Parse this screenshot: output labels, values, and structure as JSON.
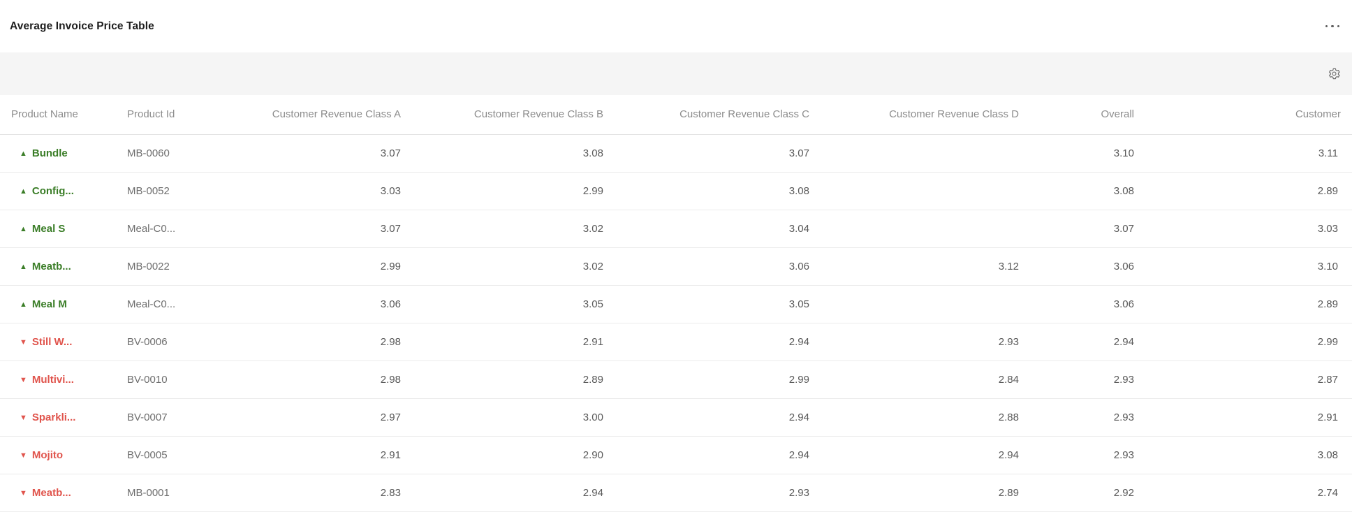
{
  "widget": {
    "title": "Average Invoice Price Table",
    "icons": {
      "more_options": "ellipsis-menu",
      "settings": "gear"
    }
  },
  "table": {
    "columns": [
      "Product Name",
      "Product Id",
      "Customer Revenue Class A",
      "Customer Revenue Class B",
      "Customer Revenue Class C",
      "Customer Revenue Class D",
      "Overall",
      "Customer"
    ],
    "rows": [
      {
        "trend": "up",
        "trend_icon": "▲",
        "name": "Bundle",
        "product_id": "MB-0060",
        "class_a": "3.07",
        "class_b": "3.08",
        "class_c": "3.07",
        "class_d": "",
        "overall": "3.10",
        "customer": "3.11"
      },
      {
        "trend": "up",
        "trend_icon": "▲",
        "name": "Config...",
        "product_id": "MB-0052",
        "class_a": "3.03",
        "class_b": "2.99",
        "class_c": "3.08",
        "class_d": "",
        "overall": "3.08",
        "customer": "2.89"
      },
      {
        "trend": "up",
        "trend_icon": "▲",
        "name": "Meal S",
        "product_id": "Meal-C0...",
        "class_a": "3.07",
        "class_b": "3.02",
        "class_c": "3.04",
        "class_d": "",
        "overall": "3.07",
        "customer": "3.03"
      },
      {
        "trend": "up",
        "trend_icon": "▲",
        "name": "Meatb...",
        "product_id": "MB-0022",
        "class_a": "2.99",
        "class_b": "3.02",
        "class_c": "3.06",
        "class_d": "3.12",
        "overall": "3.06",
        "customer": "3.10"
      },
      {
        "trend": "up",
        "trend_icon": "▲",
        "name": "Meal M",
        "product_id": "Meal-C0...",
        "class_a": "3.06",
        "class_b": "3.05",
        "class_c": "3.05",
        "class_d": "",
        "overall": "3.06",
        "customer": "2.89"
      },
      {
        "trend": "down",
        "trend_icon": "▼",
        "name": "Still W...",
        "product_id": "BV-0006",
        "class_a": "2.98",
        "class_b": "2.91",
        "class_c": "2.94",
        "class_d": "2.93",
        "overall": "2.94",
        "customer": "2.99"
      },
      {
        "trend": "down",
        "trend_icon": "▼",
        "name": "Multivi...",
        "product_id": "BV-0010",
        "class_a": "2.98",
        "class_b": "2.89",
        "class_c": "2.99",
        "class_d": "2.84",
        "overall": "2.93",
        "customer": "2.87"
      },
      {
        "trend": "down",
        "trend_icon": "▼",
        "name": "Sparkli...",
        "product_id": "BV-0007",
        "class_a": "2.97",
        "class_b": "3.00",
        "class_c": "2.94",
        "class_d": "2.88",
        "overall": "2.93",
        "customer": "2.91"
      },
      {
        "trend": "down",
        "trend_icon": "▼",
        "name": "Mojito",
        "product_id": "BV-0005",
        "class_a": "2.91",
        "class_b": "2.90",
        "class_c": "2.94",
        "class_d": "2.94",
        "overall": "2.93",
        "customer": "3.08"
      },
      {
        "trend": "down",
        "trend_icon": "▼",
        "name": "Meatb...",
        "product_id": "MB-0001",
        "class_a": "2.83",
        "class_b": "2.94",
        "class_c": "2.93",
        "class_d": "2.89",
        "overall": "2.92",
        "customer": "2.74"
      }
    ]
  },
  "colors": {
    "trend_up": "#3A7D27",
    "trend_down": "#E0544C",
    "title_text": "#1D1D1D",
    "header_text": "#8C8C8C",
    "value_text": "#595959",
    "toolbar_background": "#F5F5F5",
    "row_divider": "#EBEBEB"
  },
  "chart_data": {
    "type": "table",
    "title": "Average Invoice Price Table",
    "columns": [
      "Trend",
      "Product Name",
      "Product Id",
      "Customer Revenue Class A",
      "Customer Revenue Class B",
      "Customer Revenue Class C",
      "Customer Revenue Class D",
      "Overall",
      "Customer"
    ],
    "rows": [
      [
        "up",
        "Bundle",
        "MB-0060",
        3.07,
        3.08,
        3.07,
        null,
        3.1,
        3.11
      ],
      [
        "up",
        "Config...",
        "MB-0052",
        3.03,
        2.99,
        3.08,
        null,
        3.08,
        2.89
      ],
      [
        "up",
        "Meal S",
        "Meal-C0...",
        3.07,
        3.02,
        3.04,
        null,
        3.07,
        3.03
      ],
      [
        "up",
        "Meatb...",
        "MB-0022",
        2.99,
        3.02,
        3.06,
        3.12,
        3.06,
        3.1
      ],
      [
        "up",
        "Meal M",
        "Meal-C0...",
        3.06,
        3.05,
        3.05,
        null,
        3.06,
        2.89
      ],
      [
        "down",
        "Still W...",
        "BV-0006",
        2.98,
        2.91,
        2.94,
        2.93,
        2.94,
        2.99
      ],
      [
        "down",
        "Multivi...",
        "BV-0010",
        2.98,
        2.89,
        2.99,
        2.84,
        2.93,
        2.87
      ],
      [
        "down",
        "Sparkli...",
        "BV-0007",
        2.97,
        3.0,
        2.94,
        2.88,
        2.93,
        2.91
      ],
      [
        "down",
        "Mojito",
        "BV-0005",
        2.91,
        2.9,
        2.94,
        2.94,
        2.93,
        3.08
      ],
      [
        "down",
        "Meatb...",
        "MB-0001",
        2.83,
        2.94,
        2.93,
        2.89,
        2.92,
        2.74
      ]
    ]
  }
}
